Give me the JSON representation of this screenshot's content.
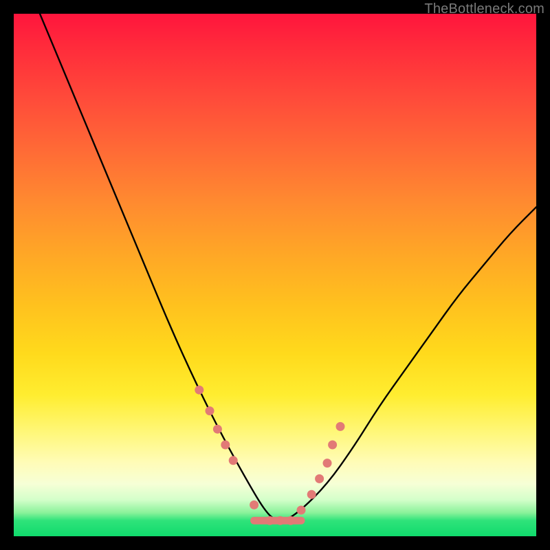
{
  "watermark": "TheBottleneck.com",
  "chart_data": {
    "type": "line",
    "title": "",
    "xlabel": "",
    "ylabel": "",
    "xlim": [
      0,
      100
    ],
    "ylim": [
      0,
      100
    ],
    "grid": false,
    "legend": false,
    "series": [
      {
        "name": "bottleneck-curve",
        "x": [
          5,
          10,
          15,
          20,
          25,
          30,
          35,
          40,
          45,
          48,
          50,
          52,
          55,
          60,
          65,
          70,
          75,
          80,
          85,
          90,
          95,
          100
        ],
        "y": [
          100,
          88,
          76,
          64,
          52,
          40,
          29,
          19,
          10,
          5,
          3,
          3,
          5,
          10,
          17,
          25,
          32,
          39,
          46,
          52,
          58,
          63
        ]
      }
    ],
    "markers": {
      "name": "highlight-points",
      "color": "#e27a76",
      "x": [
        35.5,
        37.5,
        39,
        40.5,
        42,
        46,
        49,
        51,
        53,
        55,
        57,
        58.5,
        60,
        61,
        62.5
      ],
      "y": [
        28,
        24,
        20.5,
        17.5,
        14.5,
        6,
        3,
        3,
        3,
        5,
        8,
        11,
        14,
        17.5,
        21
      ]
    },
    "trough_segment": {
      "name": "trough-bar",
      "color": "#e27a76",
      "x": [
        46,
        55
      ],
      "y": [
        3,
        3
      ]
    },
    "background": {
      "type": "vertical-gradient",
      "stops": [
        {
          "pos": 0.0,
          "color": "#ff153d"
        },
        {
          "pos": 0.36,
          "color": "#ff8a30"
        },
        {
          "pos": 0.65,
          "color": "#ffda1c"
        },
        {
          "pos": 0.9,
          "color": "#f6ffd6"
        },
        {
          "pos": 1.0,
          "color": "#10da6c"
        }
      ]
    }
  }
}
